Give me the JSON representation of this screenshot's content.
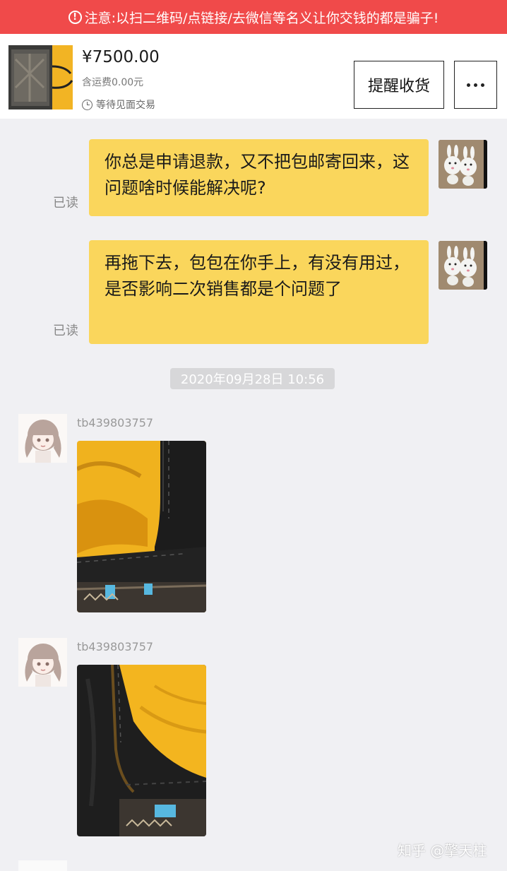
{
  "warning": {
    "icon": "!",
    "text": "注意:以扫二维码/点链接/去微信等名义让你交钱的都是骗子!"
  },
  "order": {
    "price": "¥7500.00",
    "shipping": "含运费0.00元",
    "status": "等待见面交易",
    "remind_label": "提醒收货"
  },
  "messages": [
    {
      "text": "你总是申请退款，又不把包邮寄回来，这问题啥时候能解决呢?",
      "read": "已读"
    },
    {
      "text": "再拖下去，包包在你手上，有没有用过，是否影响二次销售都是个问题了",
      "read": "已读"
    }
  ],
  "timestamp": "2020年09月28日 10:56",
  "incoming": [
    {
      "sender": "tb439803757"
    },
    {
      "sender": "tb439803757"
    }
  ],
  "watermark": "知乎 @擎天柱",
  "colors": {
    "warning_bg": "#f04a4a",
    "bubble": "#fad65c",
    "background": "#f0f0f3"
  }
}
